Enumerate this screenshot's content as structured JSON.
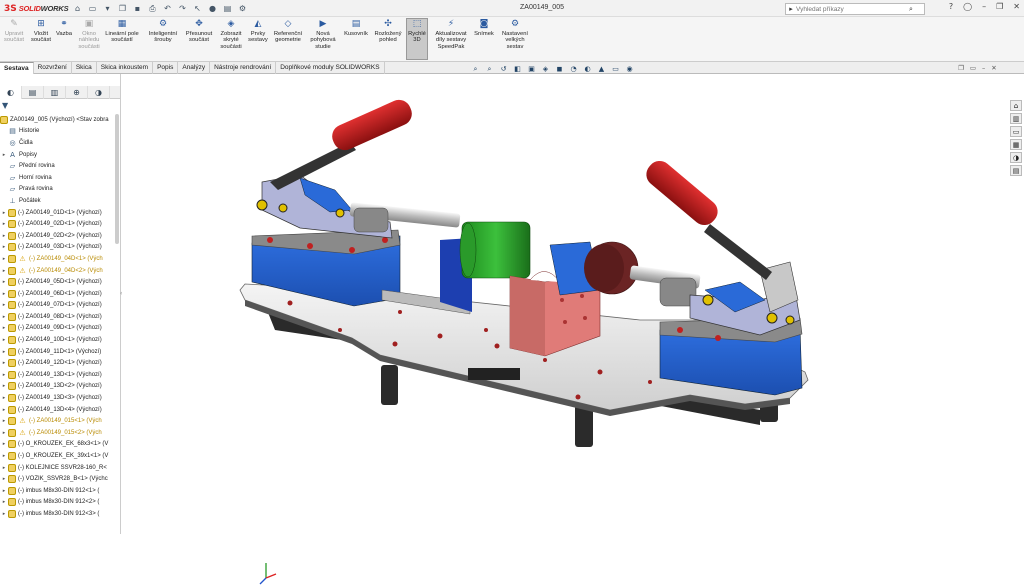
{
  "app": {
    "logo_mark": "3S",
    "logo_name": "SOLID",
    "logo_name_bold": "WORKS",
    "document_title": "ZA00149_005"
  },
  "search": {
    "placeholder": "Vyhledat příkazy"
  },
  "ribbon": [
    {
      "label": "Upravit součást",
      "icon": "edit-part-icon",
      "disabled": true
    },
    {
      "label": "Vložit součást",
      "icon": "insert-component-icon"
    },
    {
      "label": "Vazba",
      "icon": "mate-icon"
    },
    {
      "label": "Okno náhledu součásti",
      "icon": "preview-window-icon",
      "disabled": true
    },
    {
      "label": "Lineární pole součástí",
      "icon": "linear-pattern-icon"
    },
    {
      "label": "Inteligentní šrouby",
      "icon": "smart-fasteners-icon"
    },
    {
      "label": "Přesunout součást",
      "icon": "move-component-icon"
    },
    {
      "label": "Zobrazit skryté součásti",
      "icon": "show-hidden-icon"
    },
    {
      "label": "Prvky sestavy",
      "icon": "assembly-features-icon"
    },
    {
      "label": "Referenční geometrie",
      "icon": "reference-geometry-icon"
    },
    {
      "label": "Nová pohybová studie",
      "icon": "motion-study-icon"
    },
    {
      "label": "Kusovník",
      "icon": "bom-icon"
    },
    {
      "label": "Rozložený pohled",
      "icon": "exploded-view-icon"
    },
    {
      "label": "Rychlé 3D",
      "icon": "instant3d-icon",
      "active": true
    },
    {
      "label": "Aktualizovat díly sestavy SpeedPak",
      "icon": "speedpak-icon"
    },
    {
      "label": "Snímek",
      "icon": "snapshot-icon"
    },
    {
      "label": "Nastavení velkých sestav",
      "icon": "large-assembly-icon"
    }
  ],
  "tabs": [
    "Sestava",
    "Rozvržení",
    "Skica",
    "Skica inkoustem",
    "Popis",
    "Analýzy",
    "Nástroje rendrování",
    "Doplňkové moduly SOLIDWORKS"
  ],
  "tree": {
    "root": "ZA00149_005 (Výchozí) <Stav zobra",
    "items": [
      {
        "label": "Historie",
        "icon": "history-icon"
      },
      {
        "label": "Čidla",
        "icon": "sensor-icon"
      },
      {
        "label": "Popisy",
        "icon": "annotations-icon",
        "exp": true
      },
      {
        "label": "Přední rovina",
        "icon": "plane-icon"
      },
      {
        "label": "Horní rovina",
        "icon": "plane-icon"
      },
      {
        "label": "Pravá rovina",
        "icon": "plane-icon"
      },
      {
        "label": "Počátek",
        "icon": "origin-icon"
      },
      {
        "label": "(-) ZA00149_01D<1> (Výchozí)",
        "part": true
      },
      {
        "label": "(-) ZA00149_02D<1> (Výchozí)",
        "part": true
      },
      {
        "label": "(-) ZA00149_02D<2> (Výchozí)",
        "part": true
      },
      {
        "label": "(-) ZA00149_03D<1> (Výchozí)",
        "part": true
      },
      {
        "label": "(-) ZA00149_04D<1> (Vých",
        "part": true,
        "warn": true
      },
      {
        "label": "(-) ZA00149_04D<2> (Vých",
        "part": true,
        "warn": true
      },
      {
        "label": "(-) ZA00149_05D<1> (Výchozí)",
        "part": true
      },
      {
        "label": "(-) ZA00149_06D<1> (Výchozí)",
        "part": true
      },
      {
        "label": "(-) ZA00149_07D<1> (Výchozí)",
        "part": true
      },
      {
        "label": "(-) ZA00149_08D<1> (Výchozí)",
        "part": true
      },
      {
        "label": "(-) ZA00149_09D<1> (Výchozí)",
        "part": true
      },
      {
        "label": "(-) ZA00149_10D<1> (Výchozí)",
        "part": true
      },
      {
        "label": "(-) ZA00149_11D<1> (Výchozí)",
        "part": true
      },
      {
        "label": "(-) ZA00149_12D<1> (Výchozí)",
        "part": true
      },
      {
        "label": "(-) ZA00149_13D<1> (Výchozí)",
        "part": true
      },
      {
        "label": "(-) ZA00149_13D<2> (Výchozí)",
        "part": true
      },
      {
        "label": "(-) ZA00149_13D<3> (Výchozí)",
        "part": true
      },
      {
        "label": "(-) ZA00149_13D<4> (Výchozí)",
        "part": true
      },
      {
        "label": "(-) ZA00149_015<1> (Vých",
        "part": true,
        "warn": true
      },
      {
        "label": "(-) ZA00149_015<2> (Vých",
        "part": true,
        "warn": true
      },
      {
        "label": "(-) O_KROUZEK_EK_68x3<1> (V",
        "part": true
      },
      {
        "label": "(-) O_KROUZEK_EK_39x1<1> (V",
        "part": true
      },
      {
        "label": "(-) KOLEJNICE SSVR28-160_R<",
        "part": true
      },
      {
        "label": "(-) VOZIK_SSVR28_B<1> (Výchc",
        "part": true
      },
      {
        "label": "(-) imbus M8x30-DIN 912<1> (",
        "part": true
      },
      {
        "label": "(-) imbus M8x30-DIN 912<2> (",
        "part": true
      },
      {
        "label": "(-) imbus M8x30-DIN 912<3> (",
        "part": true
      }
    ]
  },
  "colors": {
    "accent": "#d22020",
    "tab_selected": "#ffffff",
    "part_icon": "#f0d060",
    "warning": "#d9a000"
  }
}
